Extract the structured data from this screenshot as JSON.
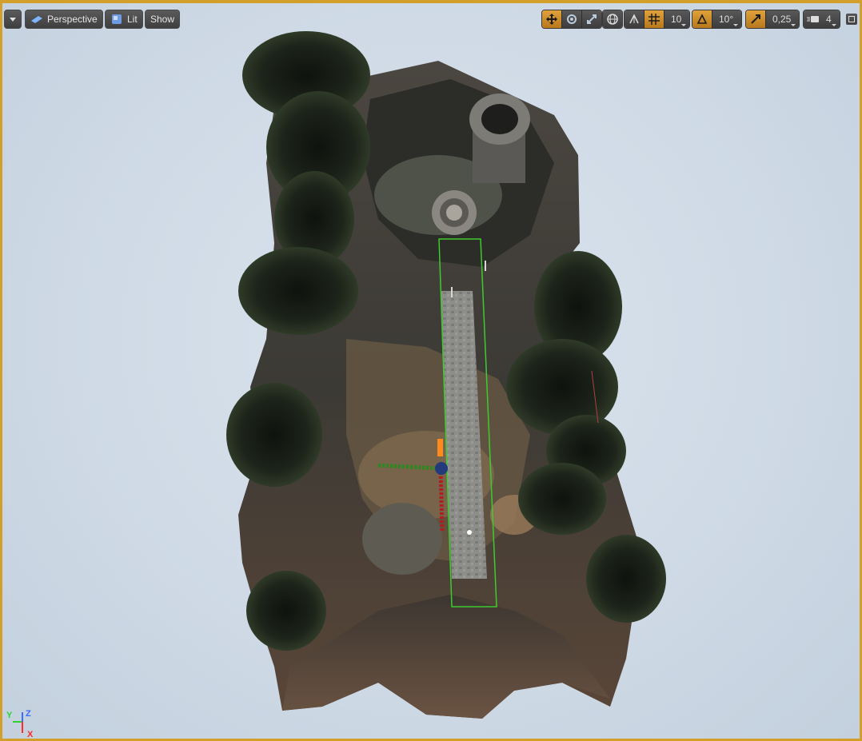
{
  "toolbar": {
    "menu_icon": "chevron-down-icon",
    "perspective_label": "Perspective",
    "lit_label": "Lit",
    "show_label": "Show",
    "grid_snap_value": "10",
    "rotation_snap_value": "10°",
    "scale_snap_value": "0,25",
    "camera_speed_value": "4",
    "accent_color": "#d39f2b"
  },
  "axis": {
    "y": "Y",
    "z": "Z",
    "x": "X"
  }
}
